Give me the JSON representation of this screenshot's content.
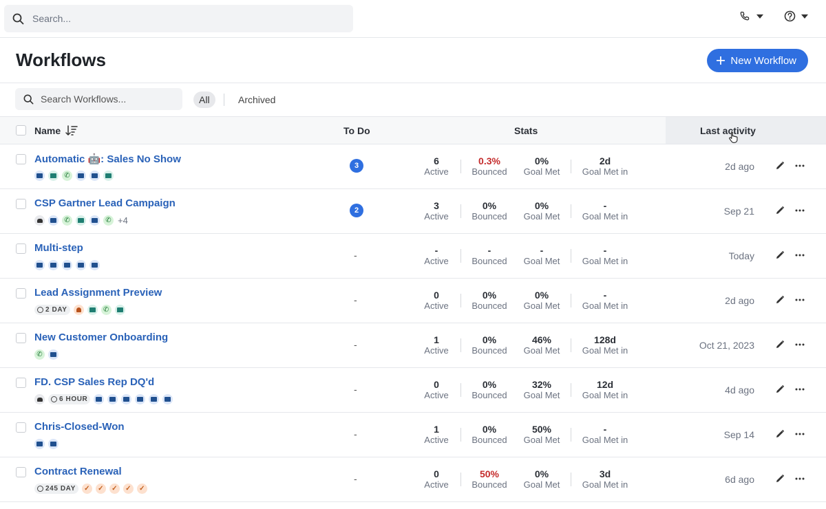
{
  "topbar": {
    "search_placeholder": "Search..."
  },
  "header": {
    "title": "Workflows",
    "new_button": "New Workflow"
  },
  "filters": {
    "search_placeholder": "Search Workflows...",
    "all": "All",
    "archived": "Archived"
  },
  "columns": {
    "name": "Name",
    "todo": "To Do",
    "stats": "Stats",
    "last_activity": "Last activity"
  },
  "rows": [
    {
      "name": "Automatic 🤖: Sales No Show",
      "todo": "3",
      "active": "6",
      "active_label": "Active",
      "bounced": "0.3%",
      "bounced_label": "Bounced",
      "goal": "0%",
      "goal_label": "Goal Met",
      "goal_in": "2d",
      "goal_in_label": "Goal Met in",
      "last": "2d ago"
    },
    {
      "name": "CSP Gartner Lead Campaign",
      "todo": "2",
      "active": "3",
      "active_label": "Active",
      "bounced": "0%",
      "bounced_label": "Bounced",
      "goal": "0%",
      "goal_label": "Goal Met",
      "goal_in": "-",
      "goal_in_label": "Goal Met in",
      "last": "Sep 21",
      "more": "+4"
    },
    {
      "name": "Multi-step",
      "todo": "-",
      "active": "-",
      "active_label": "Active",
      "bounced": "-",
      "bounced_label": "Bounced",
      "goal": "-",
      "goal_label": "Goal Met",
      "goal_in": "-",
      "goal_in_label": "Goal Met in",
      "last": "Today"
    },
    {
      "name": "Lead Assignment Preview",
      "todo": "-",
      "active": "0",
      "active_label": "Active",
      "bounced": "0%",
      "bounced_label": "Bounced",
      "goal": "0%",
      "goal_label": "Goal Met",
      "goal_in": "-",
      "goal_in_label": "Goal Met in",
      "last": "2d ago",
      "wait": "2 DAY"
    },
    {
      "name": "New Customer Onboarding",
      "todo": "-",
      "active": "1",
      "active_label": "Active",
      "bounced": "0%",
      "bounced_label": "Bounced",
      "goal": "46%",
      "goal_label": "Goal Met",
      "goal_in": "128d",
      "goal_in_label": "Goal Met in",
      "last": "Oct 21, 2023"
    },
    {
      "name": "FD. CSP Sales Rep DQ'd",
      "todo": "-",
      "active": "0",
      "active_label": "Active",
      "bounced": "0%",
      "bounced_label": "Bounced",
      "goal": "32%",
      "goal_label": "Goal Met",
      "goal_in": "12d",
      "goal_in_label": "Goal Met in",
      "last": "4d ago",
      "wait": "6 HOUR"
    },
    {
      "name": "Chris-Closed-Won",
      "todo": "-",
      "active": "1",
      "active_label": "Active",
      "bounced": "0%",
      "bounced_label": "Bounced",
      "goal": "50%",
      "goal_label": "Goal Met",
      "goal_in": "-",
      "goal_in_label": "Goal Met in",
      "last": "Sep 14"
    },
    {
      "name": "Contract Renewal",
      "todo": "-",
      "active": "0",
      "active_label": "Active",
      "bounced": "50%",
      "bounced_label": "Bounced",
      "goal": "0%",
      "goal_label": "Goal Met",
      "goal_in": "3d",
      "goal_in_label": "Goal Met in",
      "last": "6d ago",
      "wait": "245 DAY"
    }
  ]
}
